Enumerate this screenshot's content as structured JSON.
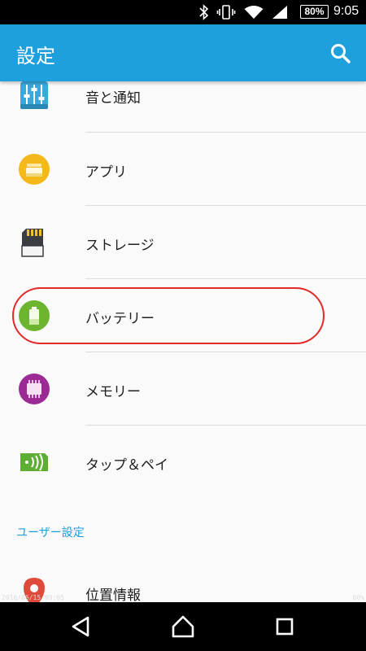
{
  "status_bar": {
    "battery": "80%",
    "time": "9:05",
    "icons": [
      "bluetooth-icon",
      "vibrate-icon",
      "wifi-icon",
      "signal-icon",
      "battery-icon"
    ]
  },
  "app_bar": {
    "title": "設定",
    "search_icon": "search-icon"
  },
  "settings": {
    "items": [
      {
        "label": "音と通知",
        "icon": "sound-equalizer-icon"
      },
      {
        "label": "アプリ",
        "icon": "apps-icon"
      },
      {
        "label": "ストレージ",
        "icon": "sd-card-icon"
      },
      {
        "label": "バッテリー",
        "icon": "battery-icon"
      },
      {
        "label": "メモリー",
        "icon": "memory-chip-icon"
      },
      {
        "label": "タップ＆ペイ",
        "icon": "nfc-pay-icon"
      }
    ]
  },
  "user_section": {
    "header": "ユーザー設定",
    "items": [
      {
        "label": "位置情報",
        "icon": "location-pin-icon"
      }
    ]
  },
  "watermark": {
    "datetime": "2016/06/15  09:05",
    "battery": "80%"
  },
  "nav_bar": {
    "icons": [
      "back-icon",
      "home-icon",
      "recents-icon"
    ]
  },
  "colors": {
    "accent": "#1ea0dc",
    "highlight": "#e22a2a"
  }
}
